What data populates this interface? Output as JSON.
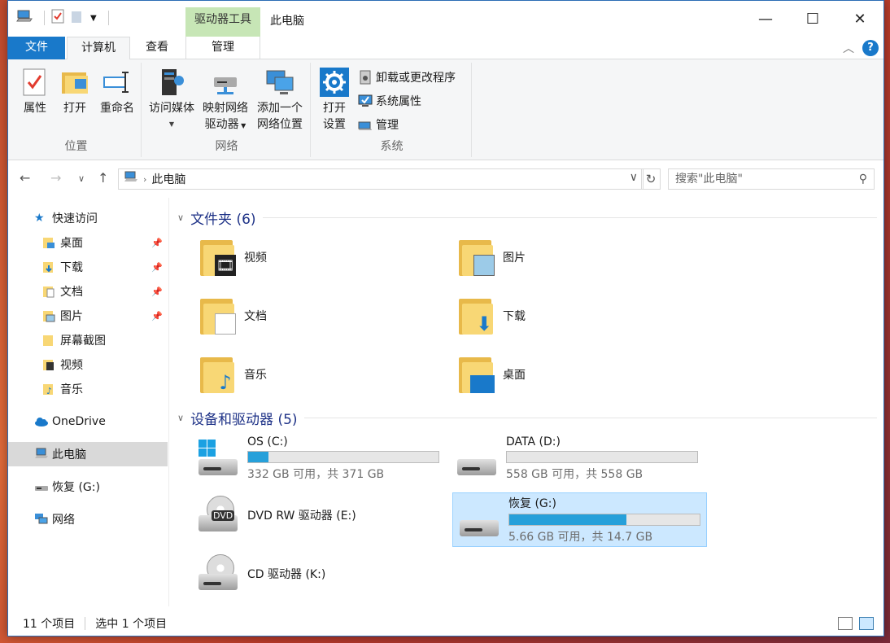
{
  "window": {
    "context_tab_label": "驱动器工具",
    "title": "此电脑",
    "controls": {
      "minimize": "—",
      "maximize": "☐",
      "close": "✕"
    }
  },
  "ribbon_tabs": {
    "file": "文件",
    "computer": "计算机",
    "view": "查看",
    "manage": "管理"
  },
  "ribbon": {
    "location": {
      "label": "位置",
      "properties": "属性",
      "open": "打开",
      "rename": "重命名"
    },
    "network": {
      "label": "网络",
      "access_media": "访问媒体",
      "map_drive_line1": "映射网络",
      "map_drive_line2": "驱动器",
      "add_location_line1": "添加一个",
      "add_location_line2": "网络位置"
    },
    "system": {
      "label": "系统",
      "open_settings_line1": "打开",
      "open_settings_line2": "设置",
      "uninstall": "卸载或更改程序",
      "system_props": "系统属性",
      "manage": "管理"
    }
  },
  "address": {
    "path": "此电脑",
    "search_placeholder": "搜索\"此电脑\""
  },
  "nav_pane": {
    "quick_access": "快速访问",
    "items": [
      {
        "label": "桌面",
        "pinned": true
      },
      {
        "label": "下载",
        "pinned": true
      },
      {
        "label": "文档",
        "pinned": true
      },
      {
        "label": "图片",
        "pinned": true
      },
      {
        "label": "屏幕截图",
        "pinned": false
      },
      {
        "label": "视频",
        "pinned": false
      },
      {
        "label": "音乐",
        "pinned": false
      }
    ],
    "onedrive": "OneDrive",
    "this_pc": "此电脑",
    "recovery": "恢复 (G:)",
    "network": "网络"
  },
  "folders": {
    "heading": "文件夹 (6)",
    "items": [
      "视频",
      "图片",
      "文档",
      "下载",
      "音乐",
      "桌面"
    ]
  },
  "drives": {
    "heading": "设备和驱动器 (5)",
    "items": [
      {
        "name": "OS (C:)",
        "detail": "332 GB 可用，共 371 GB",
        "used_fraction": 0.105
      },
      {
        "name": "DATA (D:)",
        "detail": "558 GB 可用，共 558 GB",
        "used_fraction": 0.0
      },
      {
        "name": "DVD RW 驱动器 (E:)"
      },
      {
        "name": "恢复 (G:)",
        "detail": "5.66 GB 可用，共 14.7 GB",
        "used_fraction": 0.615
      },
      {
        "name": "CD 驱动器 (K:)"
      }
    ],
    "dvd_label": "DVD"
  },
  "status": {
    "count": "11 个项目",
    "selected": "选中 1 个项目"
  },
  "colors": {
    "accent": "#1979ca",
    "context_tab": "#c7e6b6",
    "bar_fill": "#26a0da",
    "selection": "#cce8ff"
  }
}
